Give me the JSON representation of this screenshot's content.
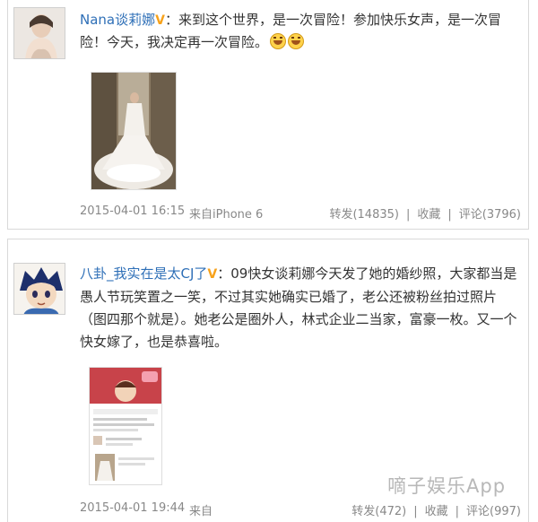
{
  "post1": {
    "username": "Nana谈莉娜",
    "body": "：来到这个世界，是一次冒险！参加快乐女声，是一次冒险！今天，我决定再一次冒险。",
    "time": "2015-04-01 16:15",
    "source": "来自iPhone 6",
    "repost": "转发(14835)",
    "favorite": "收藏",
    "comment": "评论(3796)"
  },
  "post2": {
    "username": "八卦_我实在是太CJ了",
    "body": "：09快女谈莉娜今天发了她的婚纱照，大家都当是愚人节玩笑置之一笑，不过其实她确实已婚了，老公还被粉丝拍过照片（图四那个就是）。她老公是圈外人，林式企业二当家，富豪一枚。又一个快女嫁了，也是恭喜啦。",
    "time": "2015-04-01 19:44",
    "source": "来自",
    "repost": "转发(472)",
    "favorite": "收藏",
    "comment": "评论(997)"
  },
  "watermark": "嘀子娱乐App",
  "colors": {
    "username": "#2e6fb7",
    "vbadge": "#f7a21b",
    "meta": "#888888"
  }
}
